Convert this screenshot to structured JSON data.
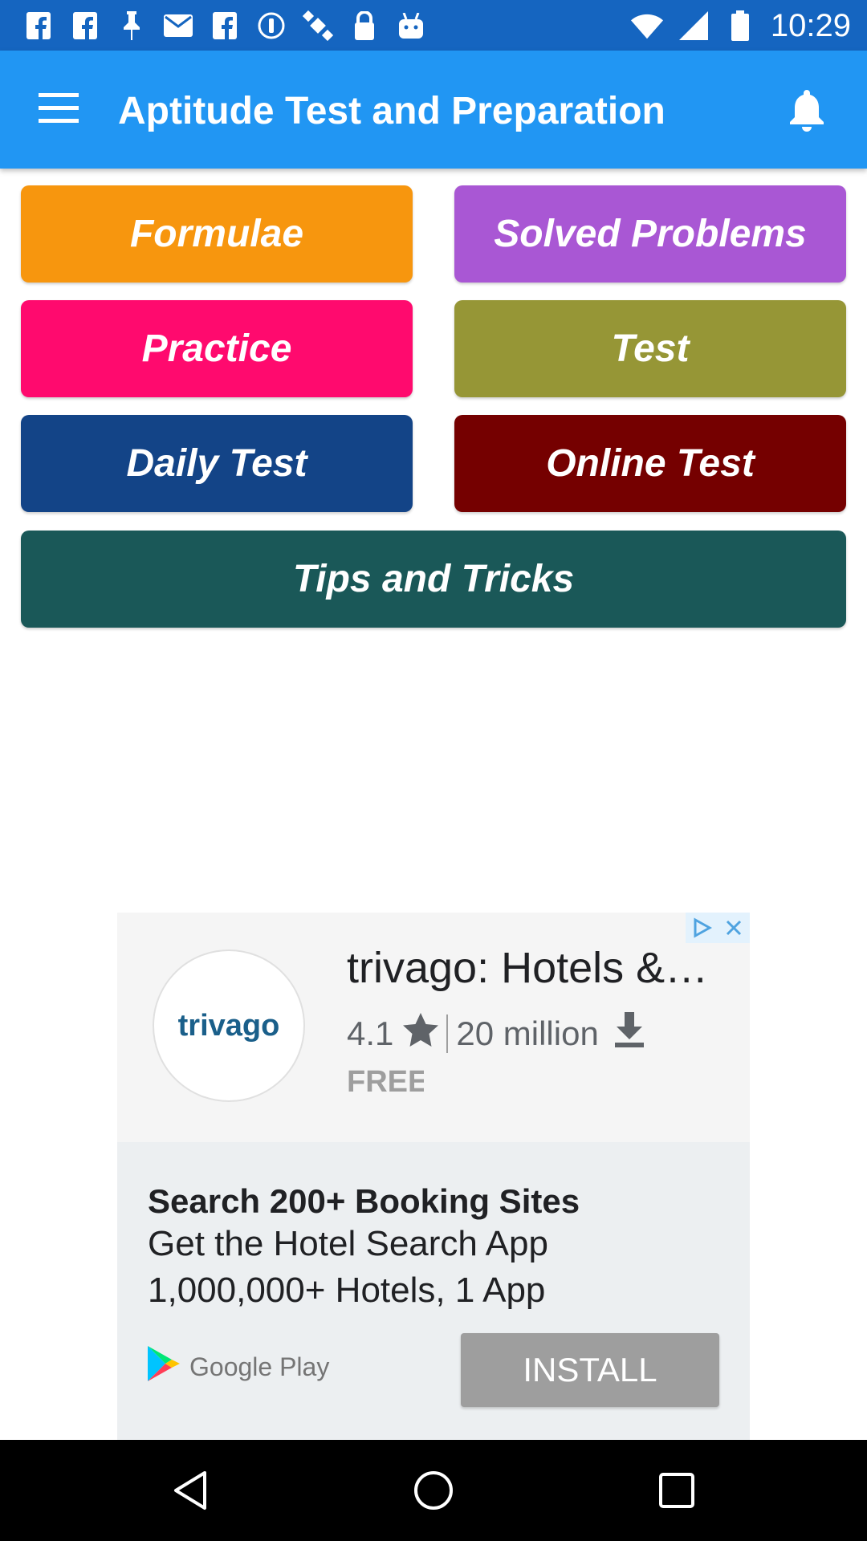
{
  "status_bar": {
    "time": "10:29",
    "icons": [
      "facebook-icon",
      "facebook-icon",
      "pin-icon",
      "mail-icon",
      "facebook-icon",
      "info-icon",
      "satellite-icon",
      "lock-icon",
      "android-icon",
      "wifi-icon",
      "signal-icon",
      "battery-icon"
    ]
  },
  "app_bar": {
    "title": "Aptitude Test and Preparation",
    "menu_icon": "hamburger-menu-icon",
    "bell_icon": "notification-bell-icon"
  },
  "tiles": [
    {
      "label": "Formulae",
      "color": "#f7960e"
    },
    {
      "label": "Solved Problems",
      "color": "#a957d4"
    },
    {
      "label": "Practice",
      "color": "#ff0a6e"
    },
    {
      "label": "Test",
      "color": "#969636"
    },
    {
      "label": "Daily Test",
      "color": "#134487"
    },
    {
      "label": "Online Test",
      "color": "#750000"
    },
    {
      "label": "Tips and Tricks",
      "color": "#1a5858"
    }
  ],
  "ad": {
    "logo_text": "trivago",
    "app_name": "trivago: Hotels &…",
    "rating": "4.1",
    "downloads": "20 million",
    "price": "FREE",
    "headline": "Search 200+ Booking Sites",
    "line1": "Get the Hotel Search App",
    "line2": "1,000,000+ Hotels, 1 App",
    "store": "Google Play",
    "install_label": "INSTALL"
  },
  "nav_bar": {
    "icons": [
      "back-icon",
      "home-icon",
      "recents-icon"
    ]
  }
}
